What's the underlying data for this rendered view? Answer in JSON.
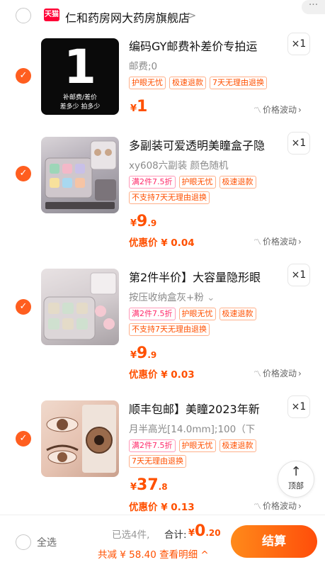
{
  "store": {
    "badge": "天猫",
    "name": "仁和药房网大药房旗舰店",
    "chevron": ">",
    "more": "···"
  },
  "items": [
    {
      "check": "✓",
      "title": "编码GY邮费补差价专拍运",
      "sku": "邮费;0",
      "qty": "×1",
      "tags": [
        "护眼无忧",
        "极速退款",
        "7天无理由退换"
      ],
      "price": {
        "cur": "¥",
        "int": "1",
        "dec": ""
      },
      "promo": "",
      "fluct": "价格波动",
      "thumb": {
        "big": "1",
        "line1": "补邮费/差价",
        "line2": "差多少 拍多少"
      }
    },
    {
      "check": "✓",
      "title": "多副装可爱透明美瞳盒子隐",
      "sku": "xy608六副装 颜色随机",
      "qty": "×1",
      "tags": [
        "满2件7.5折",
        "护眼无忧",
        "极速退款",
        "不支持7天无理由退换"
      ],
      "price": {
        "cur": "¥",
        "int": "9",
        "dec": ".9"
      },
      "promo": "优惠价 ¥ 0.04",
      "fluct": "价格波动"
    },
    {
      "check": "✓",
      "title": "第2件半价】大容量隐形眼",
      "sku": "按压收纳盒灰+粉",
      "qty": "×1",
      "tags": [
        "满2件7.5折",
        "护眼无忧",
        "极速退款",
        "不支持7天无理由退换"
      ],
      "price": {
        "cur": "¥",
        "int": "9",
        "dec": ".9"
      },
      "promo": "优惠价 ¥ 0.03",
      "fluct": "价格波动"
    },
    {
      "check": "✓",
      "title": "顺丰包邮】美瞳2023年新",
      "sku": "月半高光[14.0mm];100（下",
      "qty": "×1",
      "tags": [
        "满2件7.5折",
        "护眼无忧",
        "极速退款",
        "7天无理由退换"
      ],
      "price": {
        "cur": "¥",
        "int": "37",
        "dec": ".8"
      },
      "promo": "优惠价 ¥ 0.13",
      "fluct": "价格波动"
    }
  ],
  "back_to_top": {
    "arrow": "↑",
    "label": "顶部"
  },
  "bottom": {
    "select_all": "全选",
    "selected": "已选4件,",
    "total_label": "合计:",
    "total": {
      "cur": "¥",
      "int": "0",
      "dec": ".20"
    },
    "discount": "共减 ¥ 58.40 查看明细 ^",
    "checkout": "结算"
  },
  "colors": {
    "accent": "#ff5000",
    "checkout_start": "#ff8a1a",
    "checkout_end": "#ff4d0a"
  }
}
